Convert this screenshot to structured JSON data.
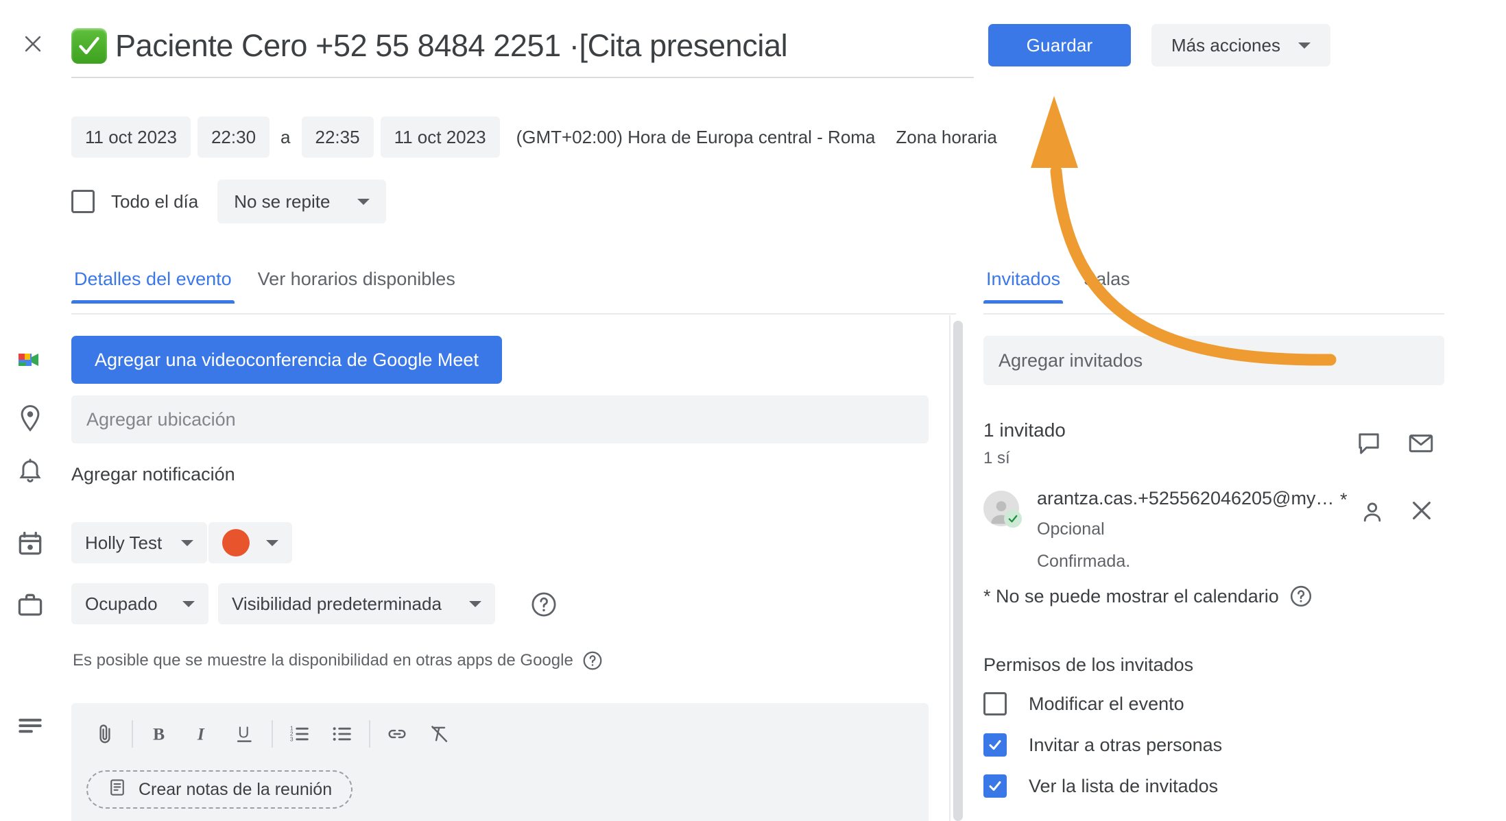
{
  "header": {
    "close_icon": "close-icon",
    "emoji": "white-check-mark",
    "title": "Paciente Cero +52 55 8484 2251 ·[Cita presencial",
    "save_label": "Guardar",
    "more_actions_label": "Más acciones"
  },
  "schedule": {
    "start_date": "11 oct 2023",
    "start_time": "22:30",
    "to_label": "a",
    "end_time": "22:35",
    "end_date": "11 oct 2023",
    "timezone_text": "(GMT+02:00) Hora de Europa central - Roma",
    "timezone_link": "Zona horaria",
    "all_day_label": "Todo el día",
    "all_day_checked": false,
    "repeat_value": "No se repite"
  },
  "left_tabs": [
    {
      "label": "Detalles del evento",
      "active": true
    },
    {
      "label": "Ver horarios disponibles",
      "active": false
    }
  ],
  "right_tabs": [
    {
      "label": "Invitados",
      "active": true
    },
    {
      "label": "Salas",
      "active": false
    }
  ],
  "details": {
    "meet_button": "Agregar una videoconferencia de Google Meet",
    "location_placeholder": "Agregar ubicación",
    "notification_label": "Agregar notificación",
    "calendar_value": "Holly Test",
    "calendar_color": "#e8552d",
    "busy_value": "Ocupado",
    "visibility_value": "Visibilidad predeterminada",
    "availability_note": "Es posible que se muestre la disponibilidad en otras apps de Google",
    "meeting_notes_chip": "Crear notas de la reunión",
    "toolbar_icons": [
      "attach-icon",
      "bold-icon",
      "italic-icon",
      "underline-icon",
      "numbered-list-icon",
      "bulleted-list-icon",
      "link-icon",
      "clear-formatting-icon"
    ]
  },
  "guests": {
    "add_placeholder": "Agregar invitados",
    "count_label": "1 invitado",
    "yes_label": "1 sí",
    "list": [
      {
        "email": "arantza.cas.+525562046205@my…",
        "star": "*",
        "optional": "Opcional",
        "status": "Confirmada."
      }
    ],
    "no_calendar_note": "* No se puede mostrar el calendario",
    "permissions_title": "Permisos de los invitados",
    "permissions": [
      {
        "label": "Modificar el evento",
        "checked": false
      },
      {
        "label": "Invitar a otras personas",
        "checked": true
      },
      {
        "label": "Ver la lista de invitados",
        "checked": true
      }
    ]
  },
  "annotation": {
    "arrow_color": "#ee9c32",
    "points_to": "Guardar"
  },
  "colors": {
    "accent_blue": "#3b78e7",
    "field_gray": "#f1f3f4",
    "text_primary": "#3c4043",
    "text_secondary": "#5f6368"
  }
}
